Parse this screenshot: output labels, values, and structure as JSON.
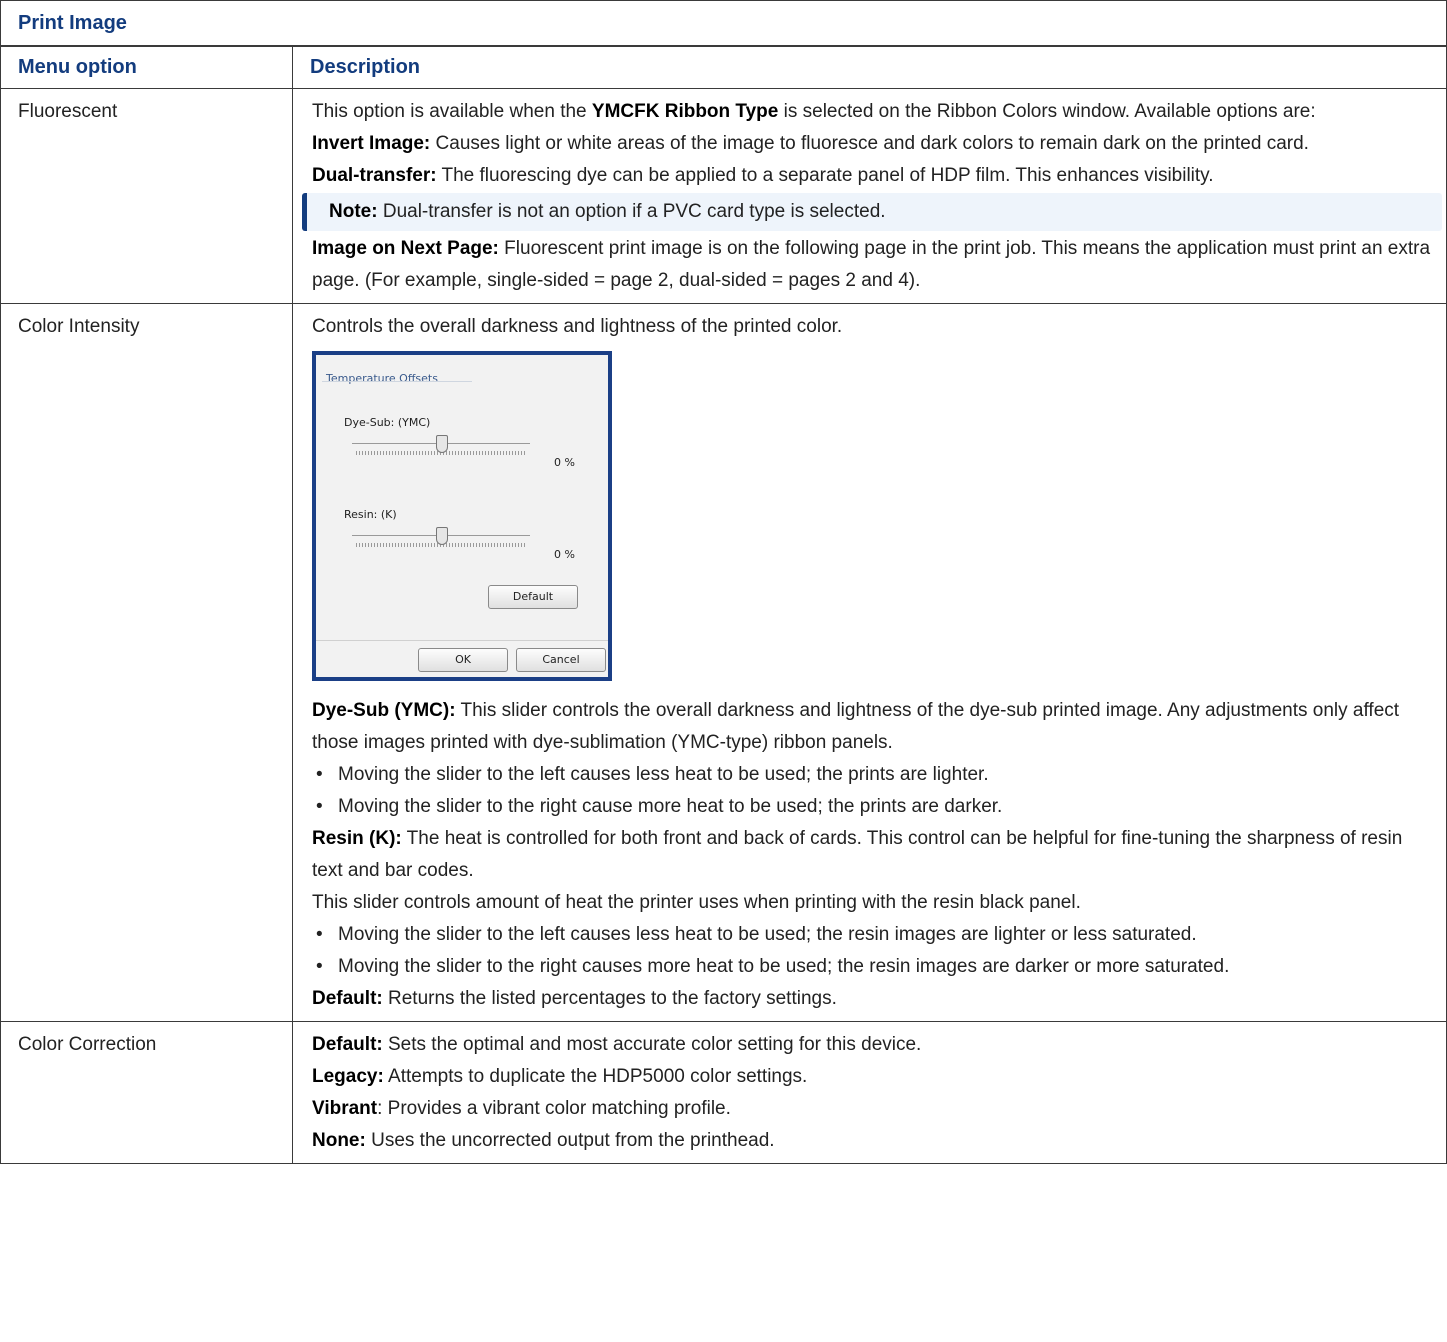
{
  "table_title": "Print Image",
  "headers": {
    "menu_option": "Menu option",
    "description": "Description"
  },
  "rows": {
    "fluorescent": {
      "option": "Fluorescent",
      "intro_a": "This option is available when the ",
      "intro_b": "YMCFK Ribbon Type",
      "intro_c": " is selected on the Ribbon Colors window. Available options are:",
      "invert_label": "Invert Image:",
      "invert_text": " Causes light or white areas of the image to fluoresce and dark colors to remain dark on the printed card.",
      "dual_label": "Dual-transfer:",
      "dual_text": " The fluorescing dye can be applied to a separate panel of HDP film. This enhances visibility.",
      "note_label": "Note:",
      "note_text": " Dual-transfer is not an option if a PVC card type is selected.",
      "next_label": "Image on Next Page:",
      "next_text": " Fluorescent print image is on the following page in the print job. This means the application must print an extra page. (For example, single-sided = page 2, dual-sided = pages 2 and 4)."
    },
    "color_intensity": {
      "option": "Color Intensity",
      "intro": "Controls the overall darkness and lightness of the printed color.",
      "dialog": {
        "heading": "Temperature Offsets",
        "dye_label": "Dye-Sub: (YMC)",
        "dye_value": "0 %",
        "dye_level_percent": 0,
        "resin_label": "Resin: (K)",
        "resin_value": "0 %",
        "resin_level_percent": 0,
        "default_button": "Default",
        "ok_button": "OK",
        "cancel_button": "Cancel"
      },
      "dye_label": "Dye-Sub (YMC):",
      "dye_text": " This slider controls the overall darkness and lightness of the dye-sub printed image. Any adjustments only affect those images printed with dye-sublimation (YMC-type) ribbon panels.",
      "dye_bullets": [
        "Moving the slider to the left causes less heat to be used; the prints are lighter.",
        "Moving the slider to the right cause more heat to be used; the prints are darker."
      ],
      "resin_label": "Resin (K):",
      "resin_text": " The heat is controlled for both front and back of cards. This control can be helpful for fine-tuning the sharpness of resin text and bar codes.",
      "resin_text2": "This slider controls amount of heat the printer uses when printing with the resin black panel.",
      "resin_bullets": [
        "Moving the slider to the left causes less heat to be used; the resin images are lighter or less saturated.",
        "Moving the slider to the right causes more heat to be used; the resin images are darker or more saturated."
      ],
      "default_label": "Default:",
      "default_text": " Returns the listed percentages to the factory settings."
    },
    "color_correction": {
      "option": "Color Correction",
      "default_label": "Default:",
      "default_text": " Sets the optimal and most accurate color setting for this device.",
      "legacy_label": "Legacy:",
      "legacy_text": " Attempts to duplicate the HDP5000 color settings.",
      "vibrant_label": "Vibrant",
      "vibrant_text": ": Provides a vibrant color matching profile.",
      "none_label": "None:",
      "none_text": " Uses the uncorrected output from the printhead."
    }
  }
}
